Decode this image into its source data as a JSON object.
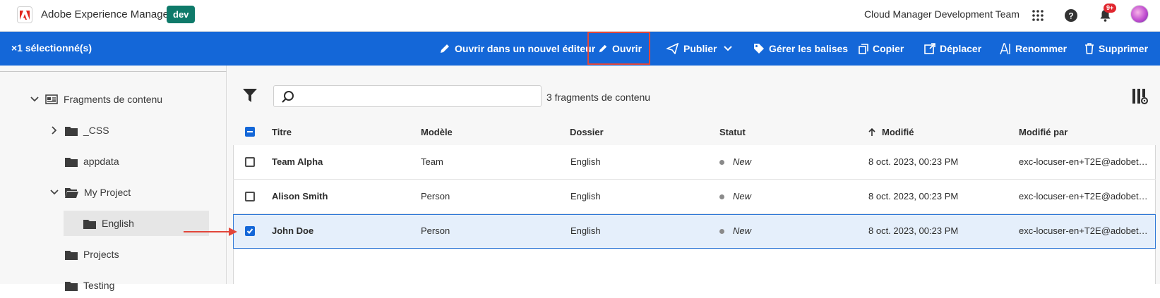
{
  "topbar": {
    "app_title": "Adobe Experience Manager",
    "env_badge": "dev",
    "org_name": "Cloud Manager Development Team",
    "notif_count": "9+",
    "icons": [
      "apps-grid-icon",
      "help-icon",
      "bell-icon",
      "avatar"
    ]
  },
  "actionbar": {
    "selection": "×1 sélectionné(s)",
    "actions": {
      "open_new_editor": "Ouvrir dans un nouvel éditeur",
      "open": "Ouvrir",
      "publish": "Publier",
      "manage_tags": "Gérer les balises",
      "copy": "Copier",
      "move": "Déplacer",
      "rename": "Renommer",
      "delete": "Supprimer"
    }
  },
  "sidebar": {
    "items": [
      {
        "label": "Fragments de contenu"
      },
      {
        "label": "_CSS"
      },
      {
        "label": "appdata"
      },
      {
        "label": "My Project"
      },
      {
        "label": "English"
      },
      {
        "label": "Projects"
      },
      {
        "label": "Testing"
      }
    ]
  },
  "main": {
    "count_text": "3 fragments de contenu",
    "search_placeholder": "",
    "columns": {
      "title": "Titre",
      "model": "Modèle",
      "folder": "Dossier",
      "status": "Statut",
      "modified": "Modifié",
      "modified_by": "Modifié par"
    },
    "rows": [
      {
        "title": "Team Alpha",
        "model": "Team",
        "folder": "English",
        "status": "New",
        "modified": "8 oct. 2023, 00:23 PM",
        "modified_by": "exc-locuser-en+T2E@adobet…",
        "selected": false
      },
      {
        "title": "Alison Smith",
        "model": "Person",
        "folder": "English",
        "status": "New",
        "modified": "8 oct. 2023, 00:23 PM",
        "modified_by": "exc-locuser-en+T2E@adobet…",
        "selected": false
      },
      {
        "title": "John Doe",
        "model": "Person",
        "folder": "English",
        "status": "New",
        "modified": "8 oct. 2023, 00:23 PM",
        "modified_by": "exc-locuser-en+T2E@adobet…",
        "selected": true
      }
    ]
  },
  "colors": {
    "accent": "#1467d8",
    "highlight": "#e2463a",
    "env_badge": "#0f7a6a"
  }
}
